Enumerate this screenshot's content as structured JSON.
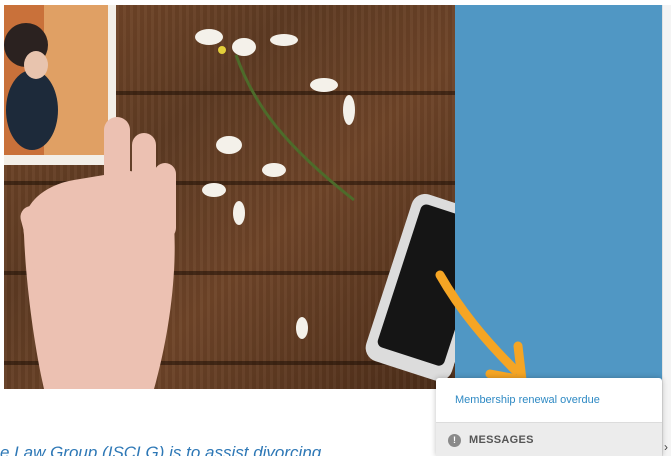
{
  "hero": {
    "image_icon": "photo-wooden-table-hand-flowers-phone"
  },
  "notification": {
    "item_label": "Membership renewal overdue",
    "section_label": "MESSAGES",
    "section_icon": "info-icon"
  },
  "page_text": "e Law Group (ISCLG) is to assist divorcing",
  "colors": {
    "panel_blue": "#5097c4",
    "link_blue": "#2f8ac4",
    "arrow_orange": "#f5a524"
  }
}
